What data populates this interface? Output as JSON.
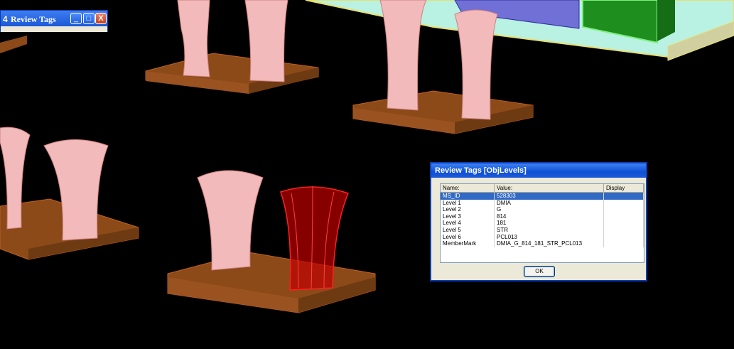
{
  "mini_window": {
    "icon": "4",
    "title": "Review Tags",
    "minimize": "_",
    "maximize": "□",
    "close": "X"
  },
  "dialog": {
    "title": "Review Tags [ObjLevels]",
    "columns": [
      "Name:",
      "Value:",
      "Display"
    ],
    "rows": [
      {
        "name": "MS_ID",
        "value": "528303",
        "display": "",
        "selected": true
      },
      {
        "name": "Level 1",
        "value": "DMIA",
        "display": ""
      },
      {
        "name": "Level 2",
        "value": "G",
        "display": ""
      },
      {
        "name": "Level 3",
        "value": "814",
        "display": ""
      },
      {
        "name": "Level 4",
        "value": "181",
        "display": ""
      },
      {
        "name": "Level 5",
        "value": "STR",
        "display": ""
      },
      {
        "name": "Level 6",
        "value": "PCL013",
        "display": ""
      },
      {
        "name": "MemberMark",
        "value": "DMIA_G_814_181_STR_PCL013",
        "display": ""
      }
    ],
    "ok_label": "OK"
  },
  "colors": {
    "background": "#000000",
    "footing": "#8b4513",
    "column": "#f1b8b8",
    "highlighted_column": "#ff0000",
    "slab": "#a0e0d0",
    "blue_wall": "#6a6ad0",
    "green_wall": "#2a9a2a",
    "selection": "#316ac5"
  }
}
